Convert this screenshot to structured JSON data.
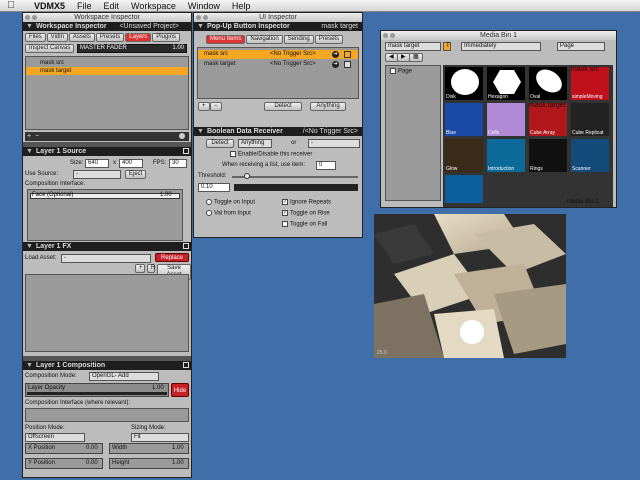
{
  "menubar": {
    "apple": "",
    "app": "VDMX5",
    "items": [
      "File",
      "Edit",
      "Workspace",
      "Window",
      "Help"
    ]
  },
  "workspace_inspector": {
    "window_title": "Workspace Inspector",
    "header": "Workspace Inspector",
    "project": "<Unsaved Project>",
    "tabs": [
      "Files",
      "Vidln",
      "Assets",
      "Presets",
      "Layers",
      "Plugins"
    ],
    "inspect_label": "Inspect Canvas",
    "master": "MASTER FADER",
    "master_value": "1.00",
    "layers": [
      "mask src",
      "mask target"
    ]
  },
  "layer_source": {
    "header": "Layer 1 Source",
    "size_label": "Size:",
    "width": "640",
    "x": "x",
    "height": "400",
    "fps_label": "FPS:",
    "fps": "30",
    "use_source_label": "Use Source:",
    "use_source": "-",
    "eject": "Eject",
    "composition_label": "Composition Interface:",
    "face_label": "Face (Optional)",
    "face_value": "1.00"
  },
  "layer_fx": {
    "header": "Layer 1 FX",
    "load_asset_label": "Load Asset:",
    "load_asset": "-",
    "replace": "Replace",
    "save_asset": "Save Asset"
  },
  "layer_composition": {
    "header": "Layer 1 Composition",
    "mode_label": "Composition Mode:",
    "mode": "OpenGL- Add",
    "opacity_label": "Layer Opacity",
    "opacity_value": "1.00",
    "hide": "Hide",
    "interface_label": "Composition Interface (where relevant):",
    "position_mode_label": "Position Mode:",
    "position_mode": "Offscreen",
    "sizing_mode_label": "Sizing Mode:",
    "sizing_mode": "Fit",
    "x_label": "X Position",
    "x_value": "0.00",
    "y_label": "Y Position",
    "y_value": "0.00",
    "width_label": "Width",
    "width_value": "1.00",
    "height_label": "Height",
    "height_value": "1.00"
  },
  "ui_inspector": {
    "window_title": "UI Inspector",
    "header": "Pop-Up Button Inspector",
    "target": "mask target",
    "tabs": [
      "Menu Items",
      "Navigation",
      "Sending",
      "Presets"
    ],
    "items": [
      {
        "name": "mask src",
        "trigger": "<No Trigger Src>"
      },
      {
        "name": "mask target",
        "trigger": "<No Trigger Src>"
      }
    ],
    "detect": "Detect",
    "anything": "Anything"
  },
  "boolean_receiver": {
    "header": "Boolean Data Receiver",
    "trigger": "/<No Trigger Src>",
    "detect": "Detect",
    "anything": "Anything",
    "or": "or",
    "dash": "-",
    "enable_label": "Enable/Disable this receiver",
    "list_label": "When receiving a list, use item:",
    "list_item": "0",
    "threshold_label": "Threshold:",
    "threshold_value": "0.10",
    "threshold_fraction": 0.1,
    "toggle_on_input": "Toggle on Input",
    "val_from_input": "Val from Input",
    "ignore_repeats": "Ignore Repeats",
    "toggle_on_rise": "Toggle on Rise",
    "toggle_on_fall": "Toggle on Fall"
  },
  "media_bin": {
    "window_title": "Media Bin 1",
    "target": "mask target",
    "trigger_mode": "Immediately",
    "page_select": "Page",
    "page_label": "Page",
    "items": [
      "Disk",
      "Hexagon",
      "Oval",
      "simpleMoving",
      "Blue",
      "Cells",
      "Cube Array",
      "Cube Replicat",
      "Glow",
      "Introduction",
      "Rings",
      "Scanner"
    ],
    "top_labels": [
      "mask src",
      "mask target"
    ],
    "footer": "Media Bin 1"
  },
  "preview": {
    "label": "25.0"
  }
}
